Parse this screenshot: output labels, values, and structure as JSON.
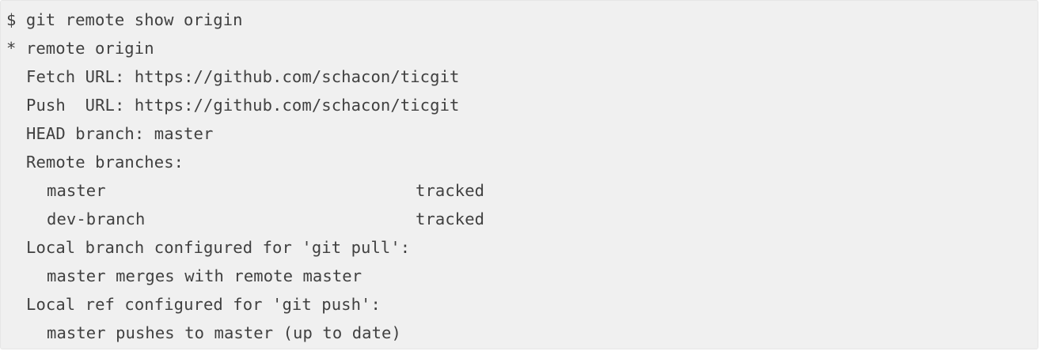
{
  "terminal": {
    "command": "$ git remote show origin",
    "remote_header": "* remote origin",
    "fetch_url": "Fetch URL: https://github.com/schacon/ticgit",
    "push_url": "Push  URL: https://github.com/schacon/ticgit",
    "head_branch": "HEAD branch: master",
    "remote_branches_label": "Remote branches:",
    "remote_branches": [
      {
        "name": "master",
        "status": "tracked"
      },
      {
        "name": "dev-branch",
        "status": "tracked"
      }
    ],
    "pull_config_label": "Local branch configured for 'git pull':",
    "pull_config_entry": "master merges with remote master",
    "push_config_label": "Local ref configured for 'git push':",
    "push_config_entry": "master pushes to master (up to date)"
  }
}
